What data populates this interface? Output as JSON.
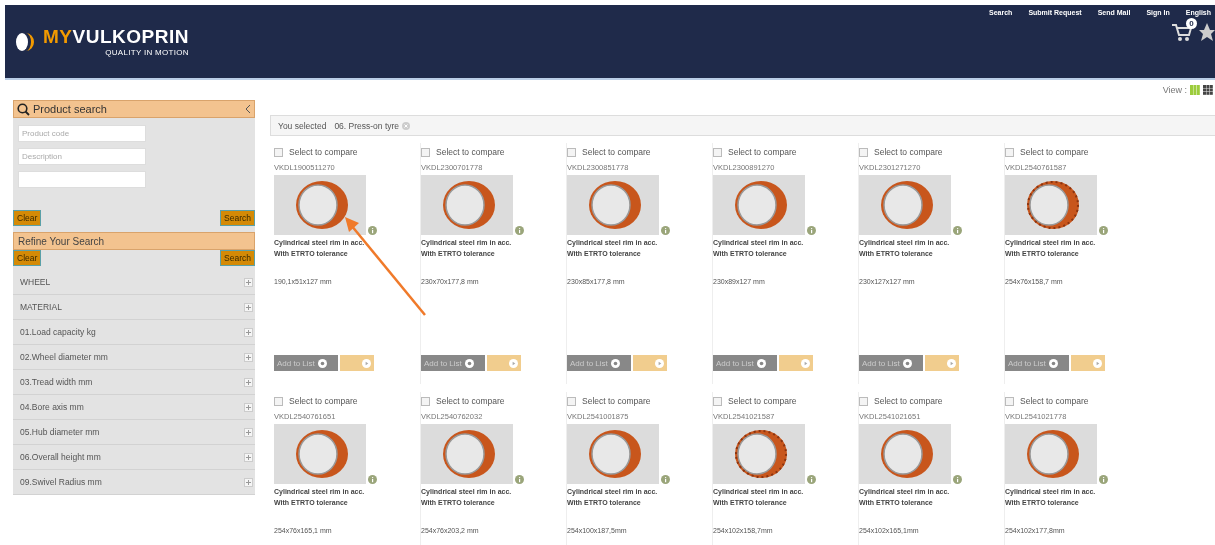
{
  "header": {
    "brand_accent": "MY",
    "brand": "VULKOPRIN",
    "tagline": "QUALITY IN MOTION",
    "nav": [
      "Search",
      "Submit Request",
      "Send Mail",
      "Sign In",
      "English"
    ],
    "cart_count": "0"
  },
  "view": {
    "label": "View :",
    "options": [
      {
        "kind": "columns",
        "selected": true
      },
      {
        "kind": "grid",
        "selected": false
      }
    ]
  },
  "sidebar": {
    "search_title": "Product search",
    "fields": [
      {
        "kind": "text",
        "placeholder": "Product code"
      },
      {
        "kind": "text",
        "placeholder": "Description"
      },
      {
        "kind": "text"
      }
    ],
    "clear": "Clear",
    "search": "Search",
    "refine_title": "Refine Your Search",
    "refine_clear": "Clear",
    "refine_search": "Search",
    "filters": [
      {
        "label": "WHEEL",
        "expanded": false
      },
      {
        "label": "MATERIAL",
        "expanded": false
      },
      {
        "label": "01.Load capacity kg",
        "expanded": false
      },
      {
        "label": "02.Wheel diameter mm",
        "expanded": false
      },
      {
        "label": "03.Tread width mm",
        "expanded": false
      },
      {
        "label": "04.Bore axis mm",
        "expanded": false
      },
      {
        "label": "05.Hub diameter mm",
        "expanded": false
      },
      {
        "label": "06.Overall height mm",
        "expanded": false
      },
      {
        "label": "09.Swivel Radius mm",
        "expanded": false
      }
    ]
  },
  "selection": {
    "label": "You selected",
    "value": "06. Press-on tyre"
  },
  "products": [
    {
      "compare": "Select to compare",
      "checked": false,
      "code": "VKDL1900511270",
      "treaded": false,
      "desc1": "Cylindrical steel rim in acc.",
      "desc2": "With ETRTO tolerance",
      "size": "190,1x51x127 mm",
      "add": "Add to List"
    },
    {
      "compare": "Select to compare",
      "checked": false,
      "code": "VKDL2300701778",
      "treaded": false,
      "desc1": "Cylindrical steel rim in acc.",
      "desc2": "With ETRTO tolerance",
      "size": "230x70x177,8 mm",
      "add": "Add to List"
    },
    {
      "compare": "Select to compare",
      "checked": false,
      "code": "VKDL2300851778",
      "treaded": false,
      "desc1": "Cylindrical steel rim in acc.",
      "desc2": "With ETRTO tolerance",
      "size": "230x85x177,8 mm",
      "add": "Add to List"
    },
    {
      "compare": "Select to compare",
      "checked": false,
      "code": "VKDL2300891270",
      "treaded": false,
      "desc1": "Cylindrical steel rim in acc.",
      "desc2": "With ETRTO tolerance",
      "size": "230x89x127 mm",
      "add": "Add to List"
    },
    {
      "compare": "Select to compare",
      "checked": false,
      "code": "VKDL2301271270",
      "treaded": false,
      "desc1": "Cylindrical steel rim in acc.",
      "desc2": "With ETRTO tolerance",
      "size": "230x127x127 mm",
      "add": "Add to List"
    },
    {
      "compare": "Select to compare",
      "checked": false,
      "code": "VKDL2540761587",
      "treaded": true,
      "desc1": "Cylindrical steel rim in acc.",
      "desc2": "With ETRTO tolerance",
      "size": "254x76x158,7 mm",
      "add": "Add to List"
    },
    {
      "compare": "Select to compare",
      "checked": false,
      "code": "VKDL2540761651",
      "treaded": false,
      "desc1": "Cylindrical steel rim in acc.",
      "desc2": "With ETRTO tolerance",
      "size": "254x76x165,1 mm"
    },
    {
      "compare": "Select to compare",
      "checked": false,
      "code": "VKDL2540762032",
      "treaded": false,
      "desc1": "Cylindrical steel rim in acc.",
      "desc2": "With ETRTO tolerance",
      "size": "254x76x203,2 mm"
    },
    {
      "compare": "Select to compare",
      "checked": false,
      "code": "VKDL2541001875",
      "treaded": false,
      "desc1": "Cylindrical steel rim in acc.",
      "desc2": "With ETRTO tolerance",
      "size": "254x100x187,5mm"
    },
    {
      "compare": "Select to compare",
      "checked": false,
      "code": "VKDL2541021587",
      "treaded": true,
      "desc1": "Cylindrical steel rim in acc.",
      "desc2": "With ETRTO tolerance",
      "size": "254x102x158,7mm"
    },
    {
      "compare": "Select to compare",
      "checked": false,
      "code": "VKDL2541021651",
      "treaded": false,
      "desc1": "Cylindrical steel rim in acc.",
      "desc2": "With ETRTO tolerance",
      "size": "254x102x165,1mm"
    },
    {
      "compare": "Select to compare",
      "checked": false,
      "code": "VKDL2541021778",
      "treaded": false,
      "desc1": "Cylindrical steel rim in acc.",
      "desc2": "With ETRTO tolerance",
      "size": "254x102x177,8mm"
    }
  ]
}
